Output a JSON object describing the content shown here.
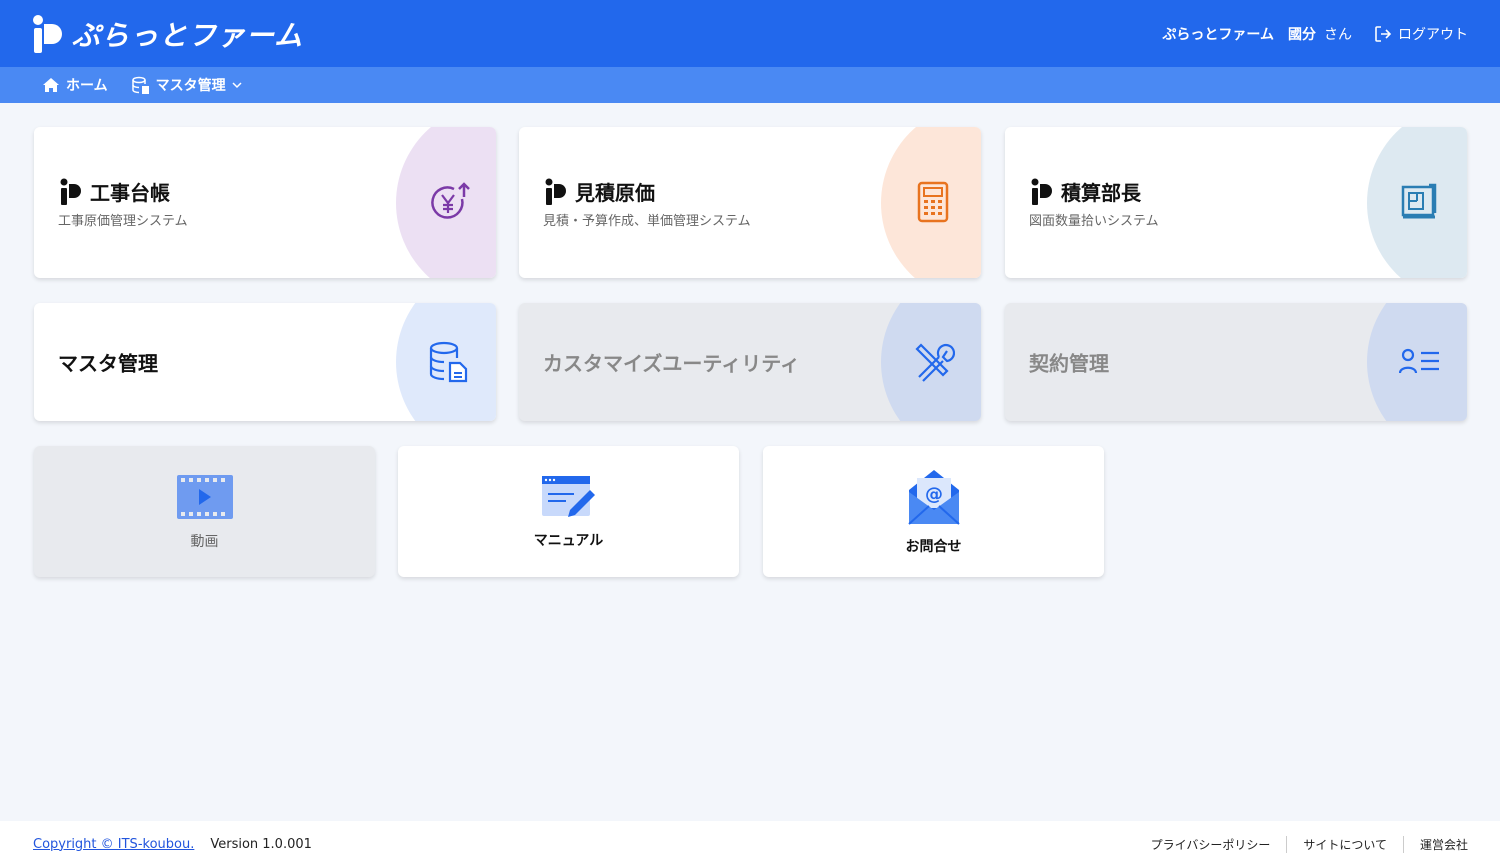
{
  "header": {
    "brand": "ぷらっとファーム",
    "company": "ぷらっとファーム",
    "user_name": "國分",
    "honorific": "さん",
    "logout": "ログアウト"
  },
  "nav": {
    "home": "ホーム",
    "master": "マスタ管理"
  },
  "systems": [
    {
      "name": "工事台帳",
      "sub": "工事原価管理システム",
      "circle_color": "#ece0f3",
      "icon_color": "#7b3aa7"
    },
    {
      "name": "見積原価",
      "sub": "見積・予算作成、単価管理システム",
      "circle_color": "#fde6d9",
      "icon_color": "#e8731f"
    },
    {
      "name": "積算部長",
      "sub": "図面数量拾いシステム",
      "circle_color": "#dde9f1",
      "icon_color": "#2a7db3"
    }
  ],
  "tools": [
    {
      "label": "マスタ管理",
      "enabled": true
    },
    {
      "label": "カスタマイズユーティリティ",
      "enabled": false
    },
    {
      "label": "契約管理",
      "enabled": false
    }
  ],
  "links": [
    {
      "label": "動画",
      "enabled": false
    },
    {
      "label": "マニュアル",
      "enabled": true
    },
    {
      "label": "お問合せ",
      "enabled": true
    }
  ],
  "footer": {
    "copyright": "Copyright © ITS-koubou.",
    "version": "Version 1.0.001",
    "links": [
      "プライバシーポリシー",
      "サイトについて",
      "運営会社"
    ]
  }
}
